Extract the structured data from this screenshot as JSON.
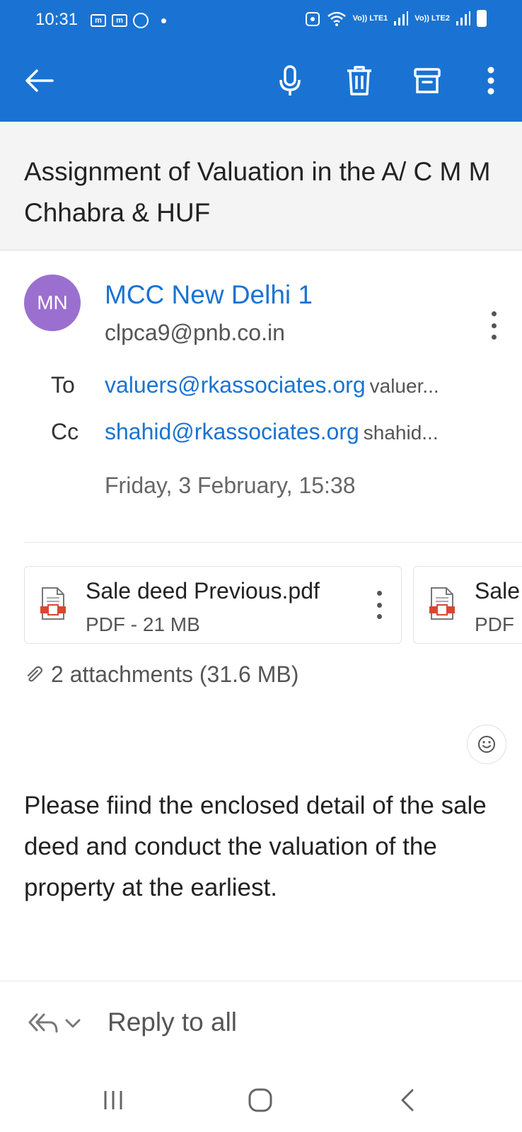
{
  "status_bar": {
    "time": "10:31",
    "left_icons": [
      "m",
      "m"
    ],
    "network1": "Vo)) LTE1",
    "network2": "Vo)) LTE2"
  },
  "toolbar": {
    "back": "arrow-back-icon",
    "mic": "microphone-icon",
    "delete": "trash-icon",
    "archive": "archive-icon",
    "more": "more-vertical-icon"
  },
  "email": {
    "subject": "Assignment of Valuation in the A/ C M M Chhabra & HUF",
    "sender": {
      "initials": "MN",
      "name": "MCC New Delhi 1",
      "email": "clpca9@pnb.co.in",
      "avatar_color": "#9b6fcf"
    },
    "to": {
      "label": "To",
      "address": "valuers@rkassociates.org",
      "name": "valuer..."
    },
    "cc": {
      "label": "Cc",
      "address": "shahid@rkassociates.org",
      "name": "shahid..."
    },
    "date": "Friday, 3 February, 15:38",
    "attachments": [
      {
        "name": "Sale deed Previous.pdf",
        "meta": "PDF - 21 MB"
      },
      {
        "name": "Sale",
        "meta": "PDF"
      }
    ],
    "attachments_summary": "2 attachments (31.6 MB)",
    "body": "Please fiind the enclosed detail of the sale deed and conduct the valuation of the property at the earliest."
  },
  "reply": {
    "label": "Reply to all"
  },
  "colors": {
    "accent": "#1a73d2",
    "pdf_red": "#d9472f"
  }
}
